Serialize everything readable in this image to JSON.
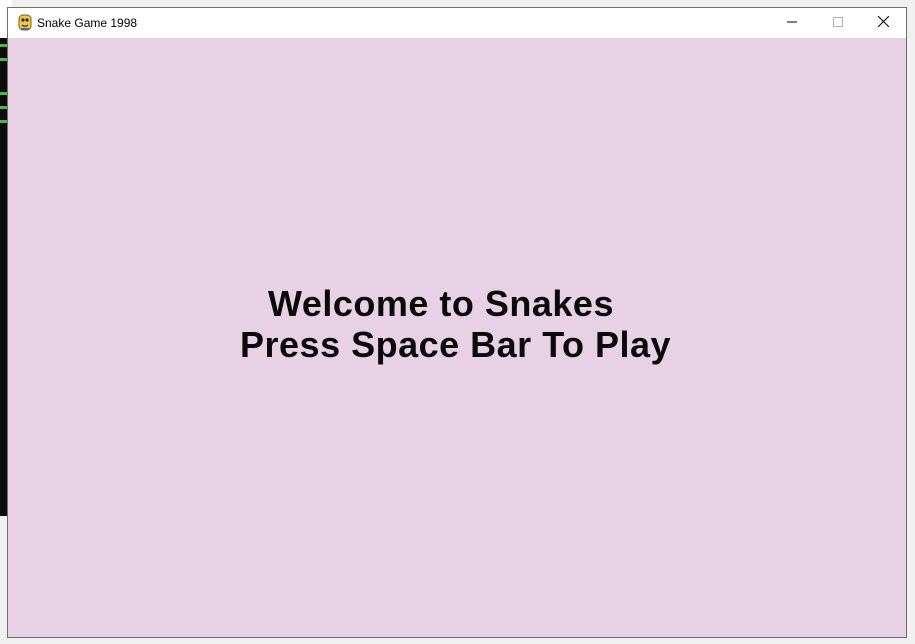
{
  "window": {
    "title": "Snake Game 1998",
    "icon": "python-snake-icon",
    "controls": {
      "minimize": "minimize-icon",
      "maximize": "maximize-icon",
      "close": "close-icon"
    }
  },
  "game": {
    "welcome_text": "Welcome to Snakes",
    "prompt_text": "Press Space Bar To Play",
    "background_color": "#e9d1e5",
    "text_color": "#0a0a0a"
  },
  "background_window": {
    "type": "terminal",
    "background_color": "#0c0c0c",
    "text_color": "#3fbf3f"
  }
}
